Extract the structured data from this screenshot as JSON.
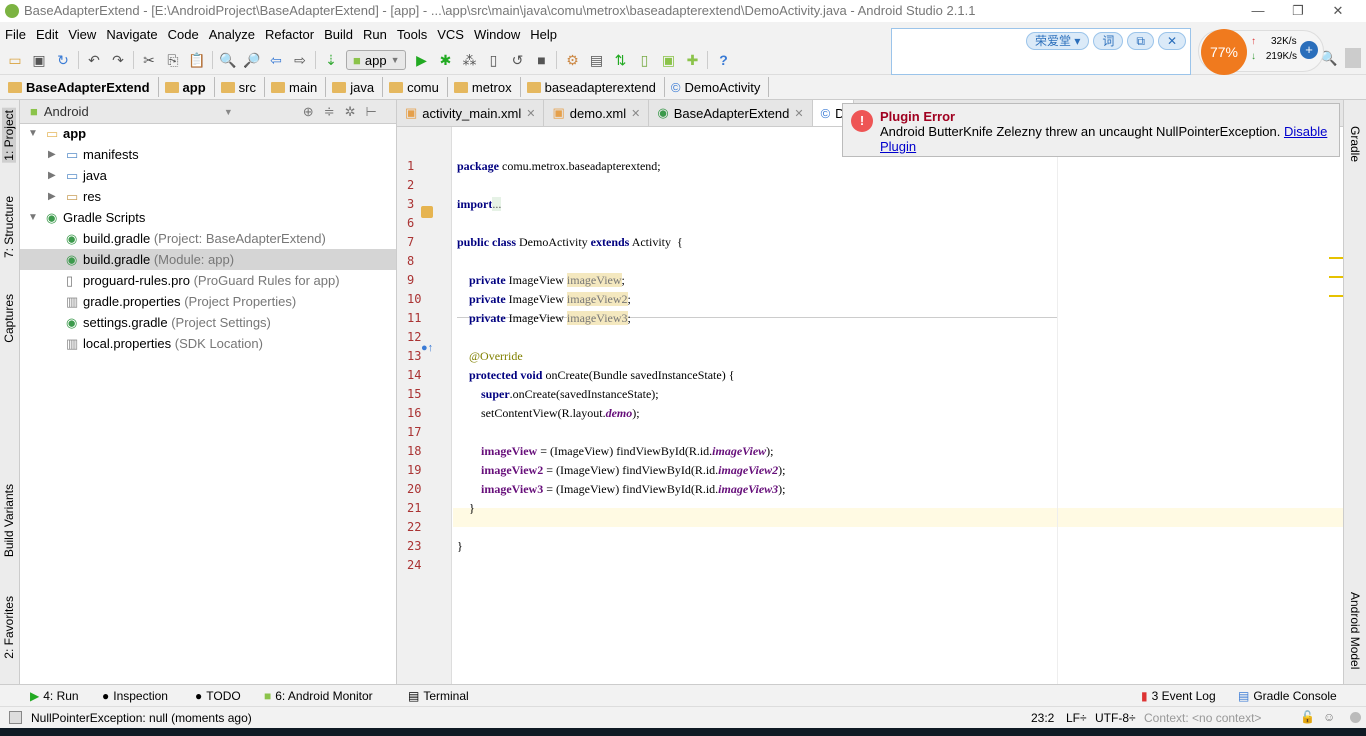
{
  "window": {
    "title": "BaseAdapterExtend - [E:\\AndroidProject\\BaseAdapterExtend] - [app] - ...\\app\\src\\main\\java\\comu\\metrox\\baseadapterextend\\DemoActivity.java - Android Studio 2.1.1",
    "minimize": "—",
    "restore": "❐",
    "close": "✕"
  },
  "menu": [
    "File",
    "Edit",
    "View",
    "Navigate",
    "Code",
    "Analyze",
    "Refactor",
    "Build",
    "Run",
    "Tools",
    "VCS",
    "Window",
    "Help"
  ],
  "toolbar": {
    "run_config": "app"
  },
  "breadcrumb": [
    "BaseAdapterExtend",
    "app",
    "src",
    "main",
    "java",
    "comu",
    "metrox",
    "baseadapterextend",
    "DemoActivity"
  ],
  "left_tools": [
    "1: Project",
    "7: Structure",
    "Captures",
    "Build Variants",
    "2: Favorites"
  ],
  "right_tools": [
    "Gradle",
    "Android Model"
  ],
  "project": {
    "view": "Android",
    "tree": [
      {
        "label": "app",
        "hint": "",
        "depth": 0,
        "expanded": true,
        "icon": "module-folder"
      },
      {
        "label": "manifests",
        "hint": "",
        "depth": 1,
        "expanded": false,
        "icon": "folder"
      },
      {
        "label": "java",
        "hint": "",
        "depth": 1,
        "expanded": false,
        "icon": "folder"
      },
      {
        "label": "res",
        "hint": "",
        "depth": 1,
        "expanded": false,
        "icon": "res-folder"
      },
      {
        "label": "Gradle Scripts",
        "hint": "",
        "depth": 0,
        "expanded": true,
        "icon": "gradle"
      },
      {
        "label": "build.gradle",
        "hint": "(Project: BaseAdapterExtend)",
        "depth": 1,
        "icon": "gradle"
      },
      {
        "label": "build.gradle",
        "hint": "(Module: app)",
        "depth": 1,
        "icon": "gradle",
        "selected": true
      },
      {
        "label": "proguard-rules.pro",
        "hint": "(ProGuard Rules for app)",
        "depth": 1,
        "icon": "file"
      },
      {
        "label": "gradle.properties",
        "hint": "(Project Properties)",
        "depth": 1,
        "icon": "properties"
      },
      {
        "label": "settings.gradle",
        "hint": "(Project Settings)",
        "depth": 1,
        "icon": "gradle"
      },
      {
        "label": "local.properties",
        "hint": "(SDK Location)",
        "depth": 1,
        "icon": "properties"
      }
    ]
  },
  "tabs": [
    {
      "label": "activity_main.xml",
      "icon": "xml"
    },
    {
      "label": "demo.xml",
      "icon": "xml"
    },
    {
      "label": "BaseAdapterExtend",
      "icon": "gradle"
    },
    {
      "label": "D",
      "icon": "class",
      "active": true
    }
  ],
  "code": {
    "lines": [
      {
        "n": "1",
        "t": [
          [
            "kw",
            "package"
          ],
          [
            "",
            "comu.metrox.baseadapterextend;"
          ]
        ]
      },
      {
        "n": "2",
        "t": []
      },
      {
        "n": "3",
        "t": [
          [
            "kw",
            "import"
          ],
          [
            "",
            ""
          ],
          [
            "fold-imp",
            "..."
          ]
        ]
      },
      {
        "n": "6",
        "t": []
      },
      {
        "n": "7",
        "t": [
          [
            "kw",
            "public class"
          ],
          [
            "",
            "DemoActivity"
          ],
          [
            "kw",
            "extends"
          ],
          [
            "",
            "Activity  {"
          ]
        ]
      },
      {
        "n": "8",
        "t": []
      },
      {
        "n": "9",
        "t": [
          [
            "",
            "    "
          ],
          [
            "kw",
            "private"
          ],
          [
            "",
            "ImageView"
          ],
          [
            "unused",
            "imageView"
          ],
          [
            "",
            ";"
          ]
        ]
      },
      {
        "n": "10",
        "t": [
          [
            "",
            "    "
          ],
          [
            "kw",
            "private"
          ],
          [
            "",
            "ImageView"
          ],
          [
            "unused",
            "imageView2"
          ],
          [
            "",
            ";"
          ]
        ]
      },
      {
        "n": "11",
        "t": [
          [
            "",
            "    "
          ],
          [
            "kw",
            "private"
          ],
          [
            "",
            "ImageView"
          ],
          [
            "unused",
            "imageView3"
          ],
          [
            "",
            ";"
          ]
        ]
      },
      {
        "n": "12",
        "t": []
      },
      {
        "n": "13",
        "t": [
          [
            "ann",
            "    @Override"
          ]
        ]
      },
      {
        "n": "14",
        "t": [
          [
            "",
            "    "
          ],
          [
            "kw",
            "protected void"
          ],
          [
            "",
            "onCreate(Bundle savedInstanceState) {"
          ]
        ]
      },
      {
        "n": "15",
        "t": [
          [
            "",
            "        "
          ],
          [
            "kw",
            "super"
          ],
          [
            "",
            ".onCreate(savedInstanceState);"
          ]
        ]
      },
      {
        "n": "16",
        "t": [
          [
            "",
            "        setContentView(R.layout."
          ],
          [
            "fldi",
            "demo"
          ],
          [
            "",
            ");"
          ]
        ]
      },
      {
        "n": "17",
        "t": []
      },
      {
        "n": "18",
        "t": [
          [
            "",
            "        "
          ],
          [
            "fld",
            "imageView"
          ],
          [
            "",
            "= (ImageView) findViewById(R.id."
          ],
          [
            "fldi",
            "imageView"
          ],
          [
            "",
            ");"
          ]
        ]
      },
      {
        "n": "19",
        "t": [
          [
            "",
            "        "
          ],
          [
            "fld",
            "imageView2"
          ],
          [
            "",
            "= (ImageView) findViewById(R.id."
          ],
          [
            "fldi",
            "imageView2"
          ],
          [
            "",
            ");"
          ]
        ]
      },
      {
        "n": "20",
        "t": [
          [
            "",
            "        "
          ],
          [
            "fld",
            "imageView3"
          ],
          [
            "",
            "= (ImageView) findViewById(R.id."
          ],
          [
            "fldi",
            "imageView3"
          ],
          [
            "",
            ");"
          ]
        ]
      },
      {
        "n": "21",
        "t": [
          [
            "",
            "    }"
          ]
        ]
      },
      {
        "n": "22",
        "t": []
      },
      {
        "n": "23",
        "t": [
          [
            "",
            "}"
          ]
        ]
      },
      {
        "n": "24",
        "t": []
      }
    ]
  },
  "notification": {
    "title": "Plugin Error",
    "message": "Android ButterKnife Zelezny threw an uncaught NullPointerException. ",
    "link": "Disable Plugin"
  },
  "ime": {
    "name": "荣爱堂 ▾",
    "btn1": "词",
    "btn2": "⧉",
    "close": "✕"
  },
  "net_monitor": {
    "percent": "77%",
    "up": "32K/s",
    "down": "219K/s"
  },
  "bottom_tools": {
    "run": "4: Run",
    "inspection": "Inspection",
    "todo": "TODO",
    "monitor": "6: Android Monitor",
    "terminal": "Terminal",
    "event_log": "3 Event Log",
    "gradle_console": "Gradle Console"
  },
  "status": {
    "message": "NullPointerException: null (moments ago)",
    "position": "23:2",
    "line_sep": "LF÷",
    "encoding": "UTF-8÷",
    "context": "Context: <no context>"
  },
  "colors": {
    "keyword": "#000080",
    "field": "#660e7a",
    "error": "#e55555",
    "accent_link": "#0000cc"
  }
}
